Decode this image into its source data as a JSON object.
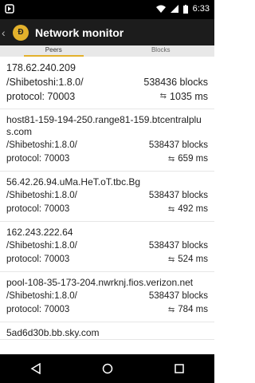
{
  "status": {
    "time": "6:33"
  },
  "app": {
    "title": "Network monitor"
  },
  "tabs": [
    {
      "label": "Peers"
    },
    {
      "label": "Blocks"
    }
  ],
  "peers": [
    {
      "host": "178.62.240.209",
      "agent": "/Shibetoshi:1.8.0/",
      "blocks": "538436 blocks",
      "protocol": "protocol: 70003",
      "ping": "1035 ms"
    },
    {
      "host": "host81-159-194-250.range81-159.btcentralplus.com",
      "agent": "/Shibetoshi:1.8.0/",
      "blocks": "538437 blocks",
      "protocol": "protocol: 70003",
      "ping": "659 ms"
    },
    {
      "host": "56.42.26.94.uMa.HeT.oT.tbc.Bg",
      "agent": "/Shibetoshi:1.8.0/",
      "blocks": "538437 blocks",
      "protocol": "protocol: 70003",
      "ping": "492 ms"
    },
    {
      "host": "162.243.222.64",
      "agent": "/Shibetoshi:1.8.0/",
      "blocks": "538437 blocks",
      "protocol": "protocol: 70003",
      "ping": "524 ms"
    },
    {
      "host": "pool-108-35-173-204.nwrknj.fios.verizon.net",
      "agent": "/Shibetoshi:1.8.0/",
      "blocks": "538437 blocks",
      "protocol": "protocol: 70003",
      "ping": "784 ms"
    },
    {
      "host": "5ad6d30b.bb.sky.com"
    }
  ]
}
